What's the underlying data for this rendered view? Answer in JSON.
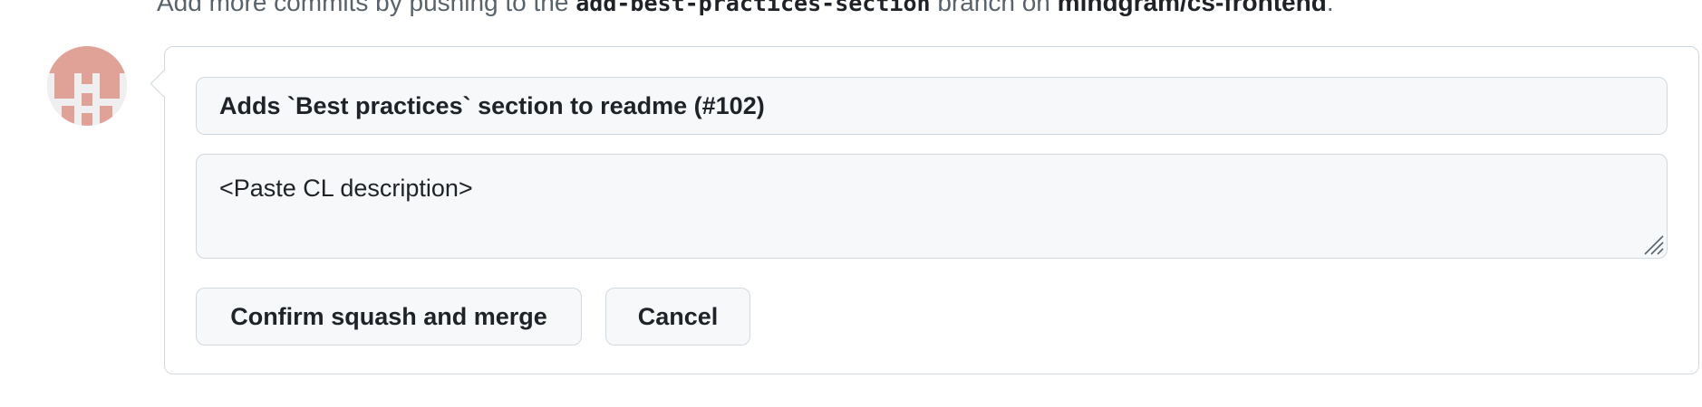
{
  "hint": {
    "prefix": "Add more commits by pushing to the ",
    "branch": "add-best-practices-section",
    "middle": " branch on ",
    "repo": "mindgram/cs-frontend",
    "suffix": "."
  },
  "avatar": {
    "icon": "identicon-avatar",
    "color": "#e0a197"
  },
  "merge_form": {
    "commit_title_value": "Adds `Best practices` section to readme (#102)",
    "commit_description_value": "<Paste CL description>",
    "confirm_label": "Confirm squash and merge",
    "cancel_label": "Cancel"
  }
}
